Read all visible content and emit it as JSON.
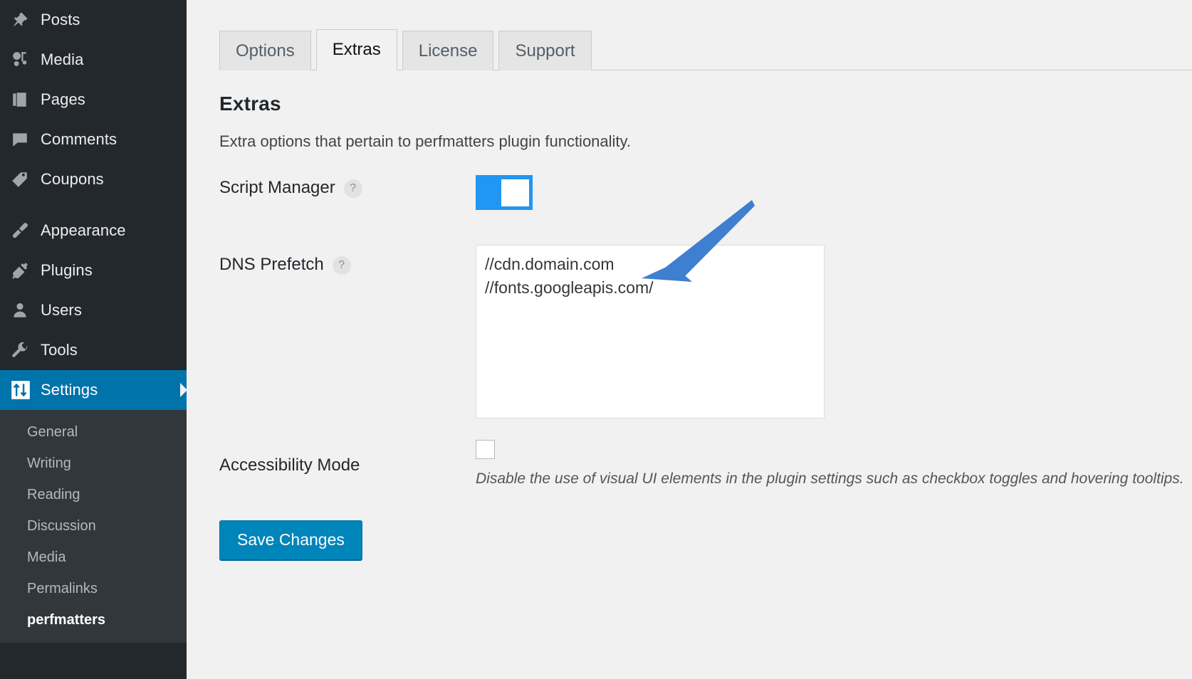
{
  "sidebar": {
    "items": [
      {
        "label": "Posts",
        "icon": "pin-icon",
        "current": false
      },
      {
        "label": "Media",
        "icon": "media-icon",
        "current": false
      },
      {
        "label": "Pages",
        "icon": "pages-icon",
        "current": false
      },
      {
        "label": "Comments",
        "icon": "comments-icon",
        "current": false
      },
      {
        "label": "Coupons",
        "icon": "tag-icon",
        "current": false
      },
      {
        "label": "Appearance",
        "icon": "paintbrush-icon",
        "current": false
      },
      {
        "label": "Plugins",
        "icon": "plug-icon",
        "current": false
      },
      {
        "label": "Users",
        "icon": "user-icon",
        "current": false
      },
      {
        "label": "Tools",
        "icon": "wrench-icon",
        "current": false
      },
      {
        "label": "Settings",
        "icon": "settings-sliders-icon",
        "current": true
      }
    ],
    "submenu": [
      {
        "label": "General",
        "current": false
      },
      {
        "label": "Writing",
        "current": false
      },
      {
        "label": "Reading",
        "current": false
      },
      {
        "label": "Discussion",
        "current": false
      },
      {
        "label": "Media",
        "current": false
      },
      {
        "label": "Permalinks",
        "current": false
      },
      {
        "label": "perfmatters",
        "current": true
      }
    ]
  },
  "tabs": [
    {
      "label": "Options",
      "active": false
    },
    {
      "label": "Extras",
      "active": true
    },
    {
      "label": "License",
      "active": false
    },
    {
      "label": "Support",
      "active": false
    }
  ],
  "section": {
    "title": "Extras",
    "description": "Extra options that pertain to perfmatters plugin functionality."
  },
  "fields": {
    "script_manager": {
      "label": "Script Manager",
      "help": "?",
      "toggle_state": "on"
    },
    "dns_prefetch": {
      "label": "DNS Prefetch",
      "help": "?",
      "value": "//cdn.domain.com\n//fonts.googleapis.com/",
      "placeholder": ""
    },
    "accessibility_mode": {
      "label": "Accessibility Mode",
      "checked": false,
      "note": "Disable the use of visual UI elements in the plugin settings such as checkbox toggles and hovering tooltips."
    }
  },
  "actions": {
    "save_label": "Save Changes"
  },
  "colors": {
    "sidebar_bg": "#23282d",
    "submenu_bg": "#32373c",
    "current_menu": "#0073aa",
    "toggle_on": "#2196f3",
    "save_button": "#0085ba",
    "annotation_arrow": "#3f7fd0",
    "content_bg": "#f1f1f1"
  },
  "annotation": {
    "arrow": "blue-arrow-pointing-to-dns-prefetch-textarea"
  }
}
